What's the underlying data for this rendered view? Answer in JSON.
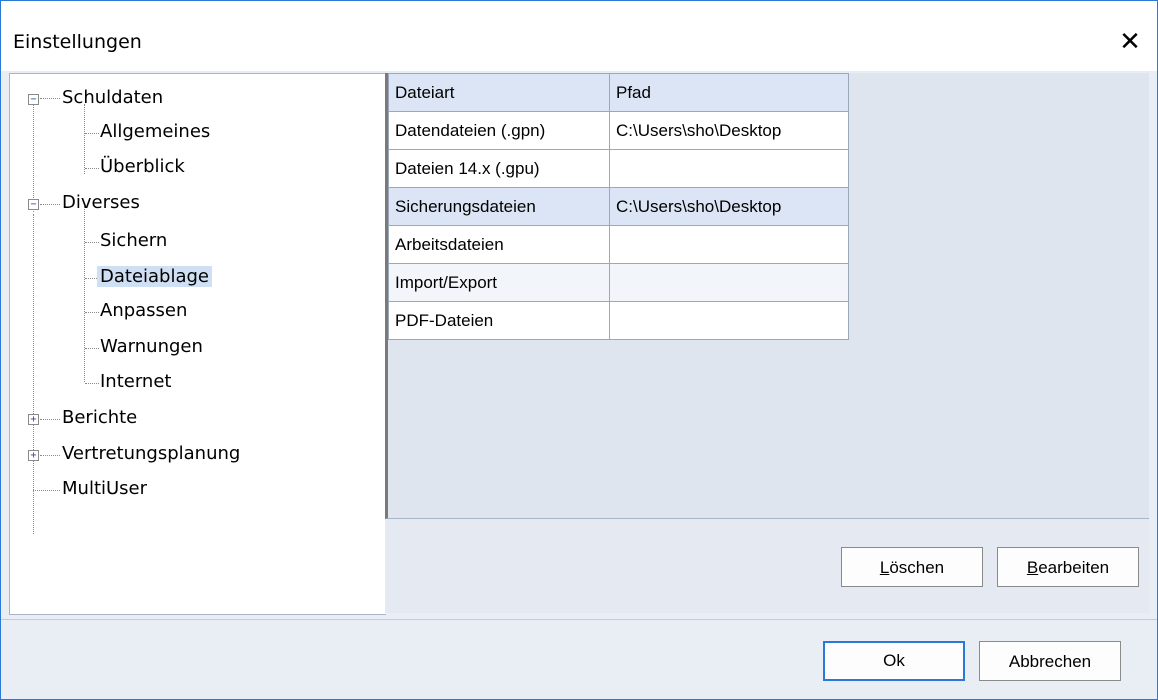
{
  "window": {
    "title": "Einstellungen",
    "close_glyph": "✕"
  },
  "tree": {
    "nodes": [
      {
        "label": "Schuldaten",
        "expander": "−"
      },
      {
        "label": "Allgemeines"
      },
      {
        "label": "Überblick"
      },
      {
        "label": "Diverses",
        "expander": "−"
      },
      {
        "label": "Sichern"
      },
      {
        "label": "Dateiablage",
        "selected": true
      },
      {
        "label": "Anpassen"
      },
      {
        "label": "Warnungen"
      },
      {
        "label": "Internet"
      },
      {
        "label": "Berichte",
        "expander": "+"
      },
      {
        "label": "Vertretungsplanung",
        "expander": "+"
      },
      {
        "label": "MultiUser"
      }
    ]
  },
  "grid": {
    "headers": [
      "Dateiart",
      "Pfad"
    ],
    "rows": [
      [
        "Datendateien (.gpn)",
        "C:\\Users\\sho\\Desktop"
      ],
      [
        "Dateien 14.x (.gpu)",
        ""
      ],
      [
        "Sicherungsdateien",
        "C:\\Users\\sho\\Desktop"
      ],
      [
        "Arbeitsdateien",
        ""
      ],
      [
        "Import/Export",
        ""
      ],
      [
        "PDF-Dateien",
        ""
      ]
    ]
  },
  "buttons": {
    "loeschen_first": "L",
    "loeschen_rest": "öschen",
    "bearbeiten_first": "B",
    "bearbeiten_rest": "earbeiten",
    "ok": "Ok",
    "abbrechen": "Abbrechen"
  },
  "colors": {
    "accent": "#2b79d6",
    "selection": "#cfe0f4",
    "panel": "#dfe5ee"
  }
}
